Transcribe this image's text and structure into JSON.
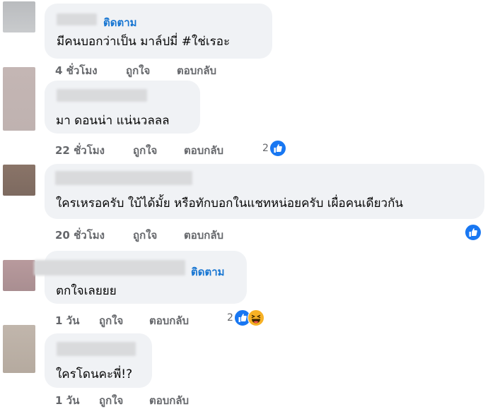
{
  "comments": [
    {
      "follow": "ติดตาม",
      "text": "มีคนบอกว่าเป็น มาล์ปมี่ #ใช่เรอะ",
      "time": "4 ชั่วโมง",
      "like": "ถูกใจ",
      "reply": "ตอบกลับ"
    },
    {
      "text": "มา ดอนน่า แน่นวลลล",
      "time": "22 ชั่วโมง",
      "like": "ถูกใจ",
      "reply": "ตอบกลับ",
      "reaction_count": "2"
    },
    {
      "text": "ใครเหรอครับ ใบ้ได้มั้ย หรือทักบอกในแชทหน่อยครับ เผื่อคนเดียวกัน",
      "time": "20 ชั่วโมง",
      "like": "ถูกใจ",
      "reply": "ตอบกลับ"
    },
    {
      "follow": "ติดตาม",
      "text": "ตกใจเลยยย",
      "time": "1 วัน",
      "like": "ถูกใจ",
      "reply": "ตอบกลับ",
      "reaction_count": "2"
    },
    {
      "text": "ใครโดนคะพี่!?",
      "time": "1 วัน",
      "like": "ถูกใจ",
      "reply": "ตอบกลับ"
    }
  ],
  "colors": {
    "link": "#1876d2",
    "bubble": "#f0f2f5",
    "meta": "#65676b",
    "like": "#1877f2",
    "haha": "#f7b125"
  },
  "icons": {
    "like": "thumbs-up-icon",
    "haha": "laughing-face-icon"
  }
}
